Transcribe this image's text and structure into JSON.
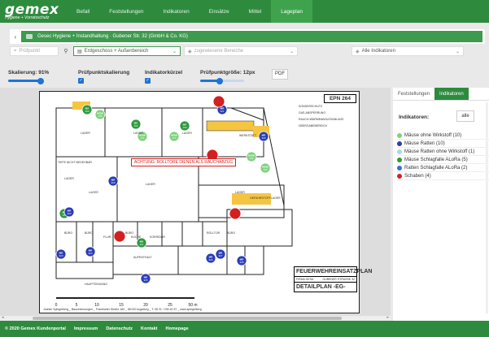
{
  "brand": {
    "name": "gemex",
    "tagline": "Hygiene + Vorratsschutz"
  },
  "nav": [
    {
      "label": "Befall",
      "active": false
    },
    {
      "label": "Feststellungen",
      "active": false
    },
    {
      "label": "Indikatoren",
      "active": false
    },
    {
      "label": "Einsätze",
      "active": false
    },
    {
      "label": "Mittel",
      "active": false
    },
    {
      "label": "Lageplan",
      "active": true
    }
  ],
  "breadcrumb": "Gesec Hygiene + Instandhaltung · Gubener Str. 32 (GmbH & Co. KG)",
  "filters": {
    "search_placeholder": "Prüfpunkt",
    "floor": "Erdgeschoss + Außenbereich",
    "areas_placeholder": "zugewiesene Bereiche",
    "indicators": "Alle Indikatoren"
  },
  "options": {
    "scale_label": "Skalierung: 91%",
    "scale_value": 0.91,
    "checkpoint_scale_label": "Prüfpunktskalierung",
    "checkpoint_scale_checked": true,
    "abbrev_label": "Indikatorkürzel",
    "abbrev_checked": true,
    "size_label": "Prüfpunktgröße: 12px",
    "size_value": 0.45,
    "pdf": "PDF"
  },
  "plan": {
    "code": "EPN 264",
    "title": "FEUERWEHREINSATZPLAN",
    "firm_label": "FIRMA GESA",
    "address": "GUBENER STRASSE 32",
    "subtitle": "DETAILPLAN -EG-",
    "warning": "ACHTUNG: ROLLTORE DIENEN ALS RAUCHABZUG",
    "scale_labels": [
      "0",
      "5",
      "10",
      "15",
      "20",
      "25",
      "50 m"
    ],
    "legend": [
      "SONDERSCHUTZ",
      "GAS-ABSPERRUNG",
      "RAUCH-WÄRMEABZUGSANLAGE",
      "ÜBERGABEBEREICH"
    ],
    "footer": "Joahim Spiegelberg _ Bauzeichnungen _ Frankfurter Straße 180 _ 86153 Augsburg _ T: 08 21 / 299 40 57 _ www.spiegelberg",
    "rooms": [
      "LAGER",
      "LAGER",
      "LAGER",
      "LAGER",
      "LAGER",
      "LAGER",
      "LAGER",
      "BÜRO",
      "BÜRO",
      "BÜRO",
      "BÜRO",
      "FLUR",
      "KÜCHE",
      "KORRIDOR",
      "ROLLTOR",
      "WERKSTATT",
      "AUFENTHALT",
      "HAUPTEINGANG",
      "TIEFE NICHT BEGEHBAR",
      "GEFAHRSTOFFLAGER"
    ]
  },
  "markers": [
    {
      "code": "MÄ",
      "num": "163",
      "color": "#2e9a3e"
    },
    {
      "code": "MÄ",
      "num": "162",
      "color": "#2e9a3e"
    },
    {
      "code": "MÄ",
      "num": "160",
      "color": "#2e9a3e"
    },
    {
      "code": "MÄ",
      "num": "164",
      "color": "#2e9a3e"
    },
    {
      "code": "MÄ",
      "num": "161",
      "color": "#2e9a3e"
    },
    {
      "code": "MOW",
      "num": "159",
      "color": "#7fd17f"
    },
    {
      "code": "MOW",
      "num": "170",
      "color": "#7fd17f"
    },
    {
      "code": "MOW",
      "num": "171",
      "color": "#7fd17f"
    },
    {
      "code": "MOW",
      "num": "192",
      "color": "#7fd17f"
    },
    {
      "code": "MOW",
      "num": "193",
      "color": "#7fd17f"
    },
    {
      "code": "MR",
      "num": "320",
      "color": "#2a3db5"
    },
    {
      "code": "MR",
      "num": "321",
      "color": "#2a3db5"
    },
    {
      "code": "MR",
      "num": "322",
      "color": "#2a3db5"
    },
    {
      "code": "MR",
      "num": "323",
      "color": "#2a3db5"
    },
    {
      "code": "MR",
      "num": "324",
      "color": "#2a3db5"
    },
    {
      "code": "MR",
      "num": "325",
      "color": "#2a3db5"
    },
    {
      "code": "MR",
      "num": "326",
      "color": "#2a3db5"
    },
    {
      "code": "MR",
      "num": "327",
      "color": "#2a3db5"
    },
    {
      "code": "MR",
      "num": "328",
      "color": "#2a3db5"
    },
    {
      "code": "MR",
      "num": "329",
      "color": "#2a3db5"
    },
    {
      "code": "",
      "num": "",
      "color": "#d42020"
    },
    {
      "code": "",
      "num": "",
      "color": "#d42020"
    },
    {
      "code": "",
      "num": "",
      "color": "#d42020"
    },
    {
      "code": "",
      "num": "",
      "color": "#d42020"
    }
  ],
  "side": {
    "tabs": [
      {
        "label": "Feststellungen",
        "active": false
      },
      {
        "label": "Indikatoren",
        "active": true
      }
    ],
    "heading": "Indikatoren:",
    "all_button": "alle",
    "items": [
      {
        "label": "Mäuse ohne Wirkstoff (10)",
        "color": "#7fd17f"
      },
      {
        "label": "Mäuse Ratten (10)",
        "color": "#2a3db5"
      },
      {
        "label": "Mäuse Ratten ohne Wirkstoff (1)",
        "color": "#a9d6f5"
      },
      {
        "label": "Mäuse Schlagfalle ALoRa (5)",
        "color": "#2e9a3e"
      },
      {
        "label": "Ratten Schlagfalle ALoRa (2)",
        "color": "#3d6fd1"
      },
      {
        "label": "Schaben (4)",
        "color": "#d42020"
      }
    ]
  },
  "footer_links": [
    "© 2020 Gemex Kundenportal",
    "Impressum",
    "Datenschutz",
    "Kontakt",
    "Homepage"
  ]
}
